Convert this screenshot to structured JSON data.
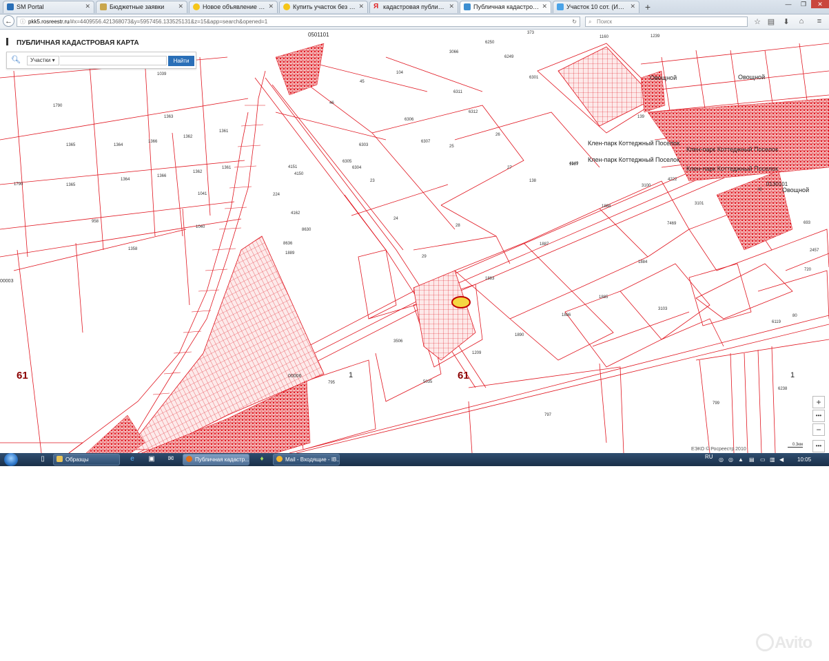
{
  "browser": {
    "tabs": [
      {
        "label": "SM Portal",
        "icon": "sm-portal-icon",
        "color": "#2a6fb7"
      },
      {
        "label": "Бюджетные заявки",
        "icon": "budget-icon",
        "color": "#c9a64b"
      },
      {
        "label": "Новое объявление — Янд...",
        "icon": "yandex-icon",
        "color": "#f5c518"
      },
      {
        "label": "Купить участок без посре...",
        "icon": "yandex-icon",
        "color": "#f5c518"
      },
      {
        "label": "кадастровая публичная к...",
        "icon": "yandex-y-icon",
        "color": "#e02020"
      },
      {
        "label": "Публичная кадастровая к...",
        "icon": "rosreestr-icon",
        "color": "#3d8fd1"
      },
      {
        "label": "Участок 10 сот. (ИЖС) - к...",
        "icon": "avito-icon",
        "color": "#4aa3e8"
      }
    ],
    "active_tab": 5,
    "new_tab_label": "+",
    "url_domain": "pkk5.rosreestr.ru",
    "url_rest": "/#x=4409556.421368073&y=5957456.133525131&z=15&app=search&opened=1",
    "search_placeholder": "Поиск"
  },
  "app": {
    "title": "ПУБЛИЧНАЯ КАДАСТРОВАЯ КАРТА",
    "search_type": "Участки",
    "search_value": "",
    "search_button": "Найти",
    "zoom_in": "+",
    "zoom_out": "−",
    "attribution": "ЕЭКО © Росреестр 2010",
    "scale_label": "0.3км"
  },
  "map": {
    "line_color": "#e0141e",
    "fill_color": "#f5c6c6",
    "block_labels": [
      {
        "text": "61",
        "style": "bignum"
      },
      {
        "text": "61",
        "style": "bignum"
      },
      {
        "text": "1",
        "style": "bignum2"
      },
      {
        "text": "1",
        "style": "bignum2"
      },
      {
        "text": "0501101",
        "style": "maplabel"
      },
      {
        "text": "0130101",
        "style": "maplabel"
      },
      {
        "text": "00003",
        "style": "maptext"
      },
      {
        "text": "00006",
        "style": "maptext"
      }
    ],
    "place_labels": [
      "Овощной",
      "Овощной",
      "Овощной",
      "Клен-парк Коттеджный Поселок",
      "Клен-парк Коттеджный Поселок",
      "Клен-парк Коттеджный Поселок",
      "Клен-парк Коттеджный Поселок"
    ],
    "parcel_labels": [
      "1039",
      "1790",
      "1363",
      "1365",
      "1364",
      "1366",
      "1362",
      "1361",
      "1790",
      "1365",
      "1364",
      "1366",
      "1362",
      "1361",
      "1041",
      "958",
      "1040",
      "1358",
      "45",
      "104",
      "46",
      "6311",
      "6312",
      "6306",
      "6303",
      "6307",
      "6305",
      "6304",
      "23",
      "24",
      "25",
      "26",
      "27",
      "28",
      "29",
      "138",
      "1927",
      "139",
      "4149",
      "4151",
      "4150",
      "224",
      "4162",
      "8630",
      "8636",
      "1889",
      "1888",
      "1887",
      "1883",
      "1884",
      "1885",
      "1886",
      "1890",
      "3103",
      "3100",
      "3101",
      "7469",
      "4222",
      "49",
      "693",
      "720",
      "2457",
      "6119",
      "80",
      "3506",
      "1209",
      "5035",
      "795",
      "797",
      "799",
      "6238",
      "6250",
      "6249",
      "6301",
      "3066",
      "373",
      "1160",
      "1239"
    ]
  },
  "taskbar": {
    "buttons": [
      {
        "label": "Образцы",
        "icon": "folder-icon",
        "color": "#e8c458"
      },
      {
        "label": "Публичная кадастр...",
        "icon": "firefox-icon",
        "color": "#e0701a"
      },
      {
        "label": "Mail - Входящие - IB...",
        "icon": "lotus-notes-icon",
        "color": "#f2b52f"
      }
    ],
    "language": "RU",
    "time": "10:05"
  },
  "watermark": "Avito"
}
